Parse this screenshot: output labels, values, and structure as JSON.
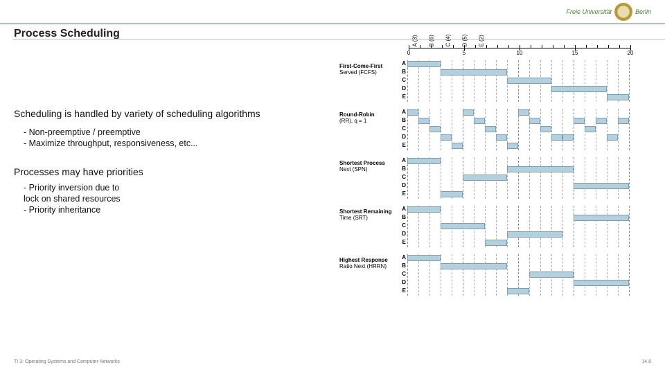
{
  "header": {
    "uni1": "Freie Universität",
    "uni2": "Berlin"
  },
  "title": "Process Scheduling",
  "content": {
    "para1": "Scheduling is handled by variety of scheduling algorithms",
    "bullets1": [
      "- Non-preemptive / preemptive",
      "- Maximize throughput, responsiveness, etc..."
    ],
    "para2": "Processes may have priorities",
    "bullets2": [
      "- Priority inversion due to",
      "  lock on shared resources",
      "- Priority inheritance"
    ]
  },
  "footer": {
    "left": "TI 3: Operating Systems and Computer Networks",
    "right": "14.8"
  },
  "chart_data": {
    "type": "gantt",
    "jobs": [
      {
        "name": "A",
        "burst": 3
      },
      {
        "name": "B",
        "burst": 6
      },
      {
        "name": "C",
        "burst": 4
      },
      {
        "name": "D",
        "burst": 5
      },
      {
        "name": "E",
        "burst": 2
      }
    ],
    "time_ticks": [
      0,
      5,
      10,
      15,
      20
    ],
    "xmax": 20,
    "schedules": [
      {
        "name": "First-Come-First\nServed (FCFS)",
        "rows": [
          {
            "label": "A",
            "segments": [
              [
                0,
                3
              ]
            ]
          },
          {
            "label": "B",
            "segments": [
              [
                3,
                9
              ]
            ]
          },
          {
            "label": "C",
            "segments": [
              [
                9,
                13
              ]
            ]
          },
          {
            "label": "D",
            "segments": [
              [
                13,
                18
              ]
            ]
          },
          {
            "label": "E",
            "segments": [
              [
                18,
                20
              ]
            ]
          }
        ]
      },
      {
        "name": "Round-Robin\n(RR), q = 1",
        "rows": [
          {
            "label": "A",
            "segments": [
              [
                0,
                1
              ],
              [
                5,
                6
              ],
              [
                10,
                11
              ]
            ]
          },
          {
            "label": "B",
            "segments": [
              [
                1,
                2
              ],
              [
                6,
                7
              ],
              [
                11,
                12
              ],
              [
                15,
                16
              ],
              [
                17,
                18
              ],
              [
                19,
                20
              ]
            ]
          },
          {
            "label": "C",
            "segments": [
              [
                2,
                3
              ],
              [
                7,
                8
              ],
              [
                12,
                13
              ],
              [
                16,
                17
              ]
            ]
          },
          {
            "label": "D",
            "segments": [
              [
                3,
                4
              ],
              [
                8,
                9
              ],
              [
                13,
                14
              ],
              [
                14,
                15
              ],
              [
                18,
                19
              ]
            ]
          },
          {
            "label": "E",
            "segments": [
              [
                4,
                5
              ],
              [
                9,
                10
              ]
            ]
          }
        ]
      },
      {
        "name": "Shortest Process\nNext (SPN)",
        "rows": [
          {
            "label": "A",
            "segments": [
              [
                0,
                3
              ]
            ]
          },
          {
            "label": "B",
            "segments": [
              [
                9,
                15
              ]
            ]
          },
          {
            "label": "C",
            "segments": [
              [
                5,
                9
              ]
            ]
          },
          {
            "label": "D",
            "segments": [
              [
                15,
                20
              ]
            ]
          },
          {
            "label": "E",
            "segments": [
              [
                3,
                5
              ]
            ]
          }
        ]
      },
      {
        "name": "Shortest Remaining\nTime (SRT)",
        "rows": [
          {
            "label": "A",
            "segments": [
              [
                0,
                3
              ]
            ]
          },
          {
            "label": "B",
            "segments": [
              [
                15,
                20
              ]
            ]
          },
          {
            "label": "C",
            "segments": [
              [
                3,
                7
              ]
            ]
          },
          {
            "label": "D",
            "segments": [
              [
                9,
                14
              ]
            ]
          },
          {
            "label": "E",
            "segments": [
              [
                7,
                9
              ]
            ]
          }
        ]
      },
      {
        "name": "Highest Response\nRatio Next (HRRN)",
        "rows": [
          {
            "label": "A",
            "segments": [
              [
                0,
                3
              ]
            ]
          },
          {
            "label": "B",
            "segments": [
              [
                3,
                9
              ]
            ]
          },
          {
            "label": "C",
            "segments": [
              [
                11,
                15
              ]
            ]
          },
          {
            "label": "D",
            "segments": [
              [
                15,
                20
              ]
            ]
          },
          {
            "label": "E",
            "segments": [
              [
                9,
                11
              ]
            ]
          }
        ]
      }
    ]
  }
}
